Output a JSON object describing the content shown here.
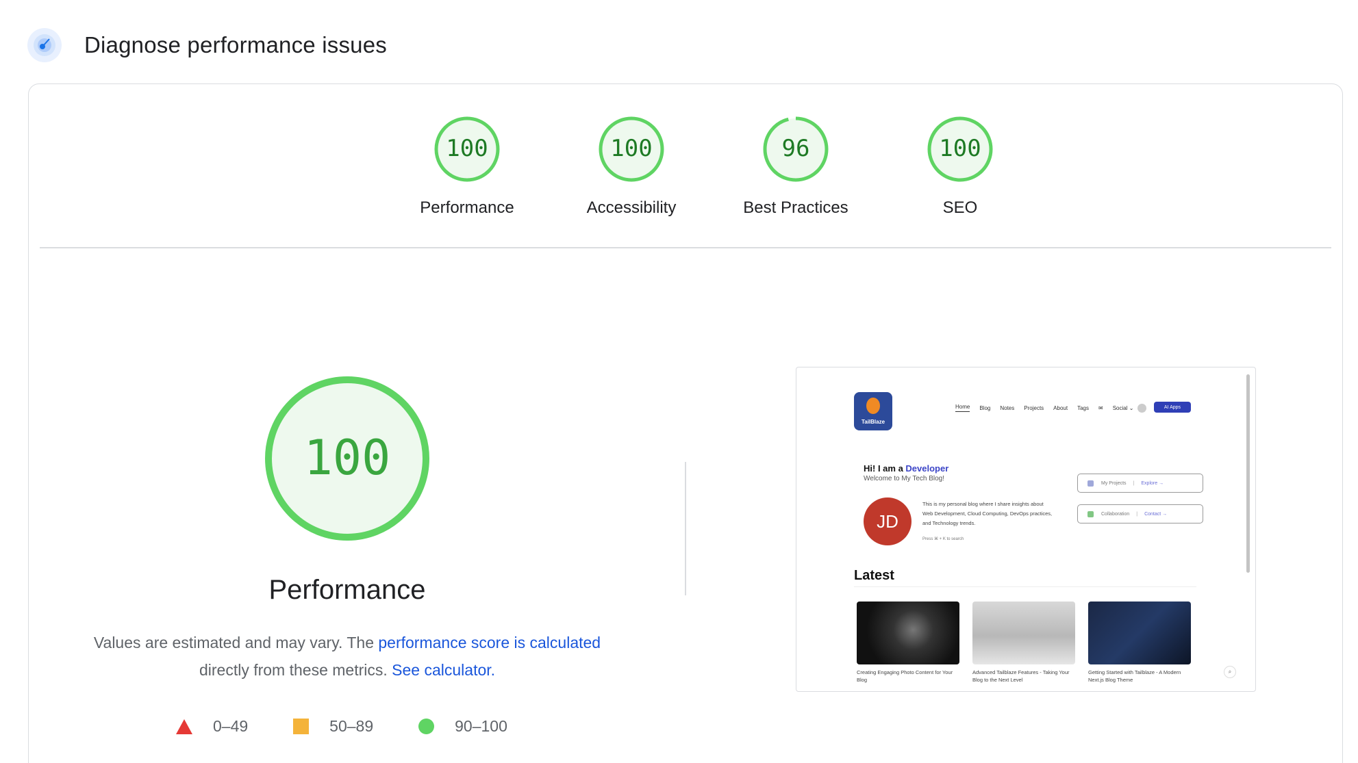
{
  "header": {
    "title": "Diagnose performance issues",
    "icon": "lighthouse-icon"
  },
  "gauges": [
    {
      "score": "100",
      "label": "Performance"
    },
    {
      "score": "100",
      "label": "Accessibility"
    },
    {
      "score": "96",
      "label": "Best Practices"
    },
    {
      "score": "100",
      "label": "SEO"
    }
  ],
  "performance": {
    "score": "100",
    "title": "Performance",
    "desc_prefix": "Values are estimated and may vary. The",
    "link_score": "performance score is calculated",
    "desc_middle": "directly from these metrics.",
    "link_calculator": "See calculator."
  },
  "legend": [
    {
      "range": "0–49",
      "shape": "triangle",
      "color": "#e53935"
    },
    {
      "range": "50–89",
      "shape": "square",
      "color": "#f4b33a"
    },
    {
      "range": "90–100",
      "shape": "circle",
      "color": "#5fd463"
    }
  ],
  "colors": {
    "pass": "#5fd463",
    "pass_text": "#1e7a24",
    "pass_bg": "#eef9ee",
    "link": "#1a56db"
  },
  "screenshot": {
    "logo_text": "TailBlaze",
    "nav": [
      "Home",
      "Blog",
      "Notes",
      "Projects",
      "About",
      "Tags",
      "✉",
      "Social ⌄"
    ],
    "apps_button": "AI Apps",
    "greeting_prefix": "Hi! I am a",
    "greeting_role": "Developer",
    "welcome": "Welcome to My Tech Blog!",
    "avatar_initials": "JD",
    "bio": "This is my personal blog where I share insights about Web Development, Cloud Computing, DevOps practices, and Technology trends.",
    "press_hint": "Press ⌘ + K to search",
    "pills": [
      {
        "label": "My Projects",
        "link": "Explore →"
      },
      {
        "label": "Collaboration",
        "link": "Contact →"
      }
    ],
    "latest_title": "Latest",
    "posts": [
      "Creating Engaging Photo Content for Your Blog",
      "Advanced Tailblaze Features - Taking Your Blog to the Next Level",
      "Getting Started with Tailblaze - A Modern Next.js Blog Theme"
    ]
  }
}
